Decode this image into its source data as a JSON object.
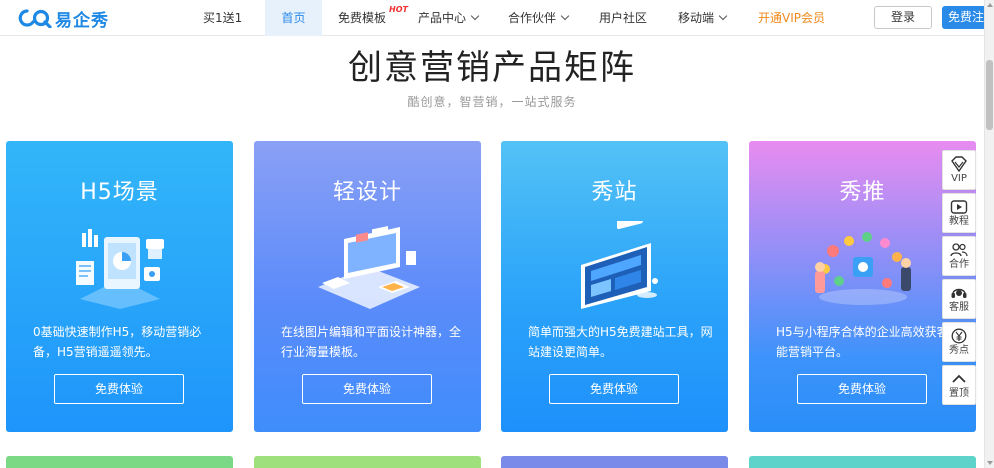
{
  "brand": {
    "name": "易企秀"
  },
  "nav": {
    "items": [
      {
        "label": "买1送1"
      },
      {
        "label": "首页"
      },
      {
        "label": "免费模板",
        "badge": "HOT"
      },
      {
        "label": "产品中心"
      },
      {
        "label": "合作伙伴"
      },
      {
        "label": "用户社区"
      },
      {
        "label": "移动端"
      },
      {
        "label": "开通VIP会员"
      }
    ],
    "login": "登录",
    "register": "免费注"
  },
  "section": {
    "title": "创意营销产品矩阵",
    "subtitle": "酷创意，智营销，一站式服务"
  },
  "cards": [
    {
      "title": "H5场景",
      "desc": "0基础快速制作H5，移动营销必备，H5营销遥遥领先。",
      "button": "免费体验"
    },
    {
      "title": "轻设计",
      "desc": "在线图片编辑和平面设计神器，全行业海量模板。",
      "button": "免费体验"
    },
    {
      "title": "秀站",
      "desc": "简单而强大的H5免费建站工具，网站建设更简单。",
      "button": "免费体验"
    },
    {
      "title": "秀推",
      "desc": "H5与小程序合体的企业高效获客智能营销平台。",
      "button": "免费体验"
    }
  ],
  "float_bar": [
    {
      "label": "VIP",
      "icon": "diamond-icon"
    },
    {
      "label": "教程",
      "icon": "play-icon"
    },
    {
      "label": "合作",
      "icon": "users-icon"
    },
    {
      "label": "客服",
      "icon": "headset-icon"
    },
    {
      "label": "秀点",
      "icon": "yen-icon"
    },
    {
      "label": "置顶",
      "icon": "chevron-up-icon"
    }
  ],
  "colors": {
    "brand_blue": "#2a8ae8",
    "vip_orange": "#f08a1c",
    "hot_red": "#e33"
  }
}
